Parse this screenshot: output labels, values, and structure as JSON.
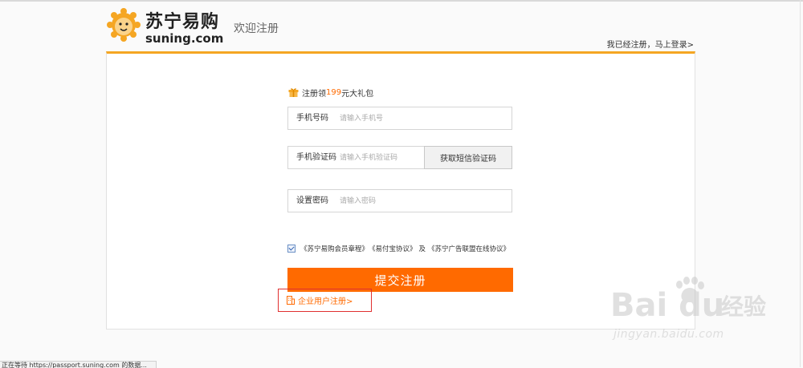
{
  "header": {
    "logo_cn": "苏宁易购",
    "logo_en": "suning.com",
    "welcome": "欢迎注册",
    "login_link": "我已经注册，马上登录>"
  },
  "promo": {
    "prefix": "注册领",
    "amount": "199",
    "suffix": "元大礼包"
  },
  "form": {
    "phone": {
      "label": "手机号码",
      "placeholder": "请输入手机号",
      "value": ""
    },
    "sms": {
      "label": "手机验证码",
      "placeholder": "请输入手机验证码",
      "value": "",
      "button": "获取短信验证码"
    },
    "password": {
      "label": "设置密码",
      "placeholder": "请输入密码",
      "value": ""
    }
  },
  "agreement": {
    "checked": true,
    "item1": "《苏宁易购会员章程》",
    "item2": "《易付宝协议》",
    "joiner": "及",
    "item3": "《苏宁广告联盟在线协议》"
  },
  "submit_label": "提交注册",
  "enterprise_link": "企业用户注册>",
  "watermark": {
    "brand": "Bai du",
    "cn": "经验",
    "url": "jingyan.baidu.com"
  },
  "status_text": "正在等待 https://passport.suning.com 的数据...",
  "colors": {
    "accent": "#ff6a00",
    "panel_top": "#f5a623",
    "highlight_box": "#e03030"
  }
}
